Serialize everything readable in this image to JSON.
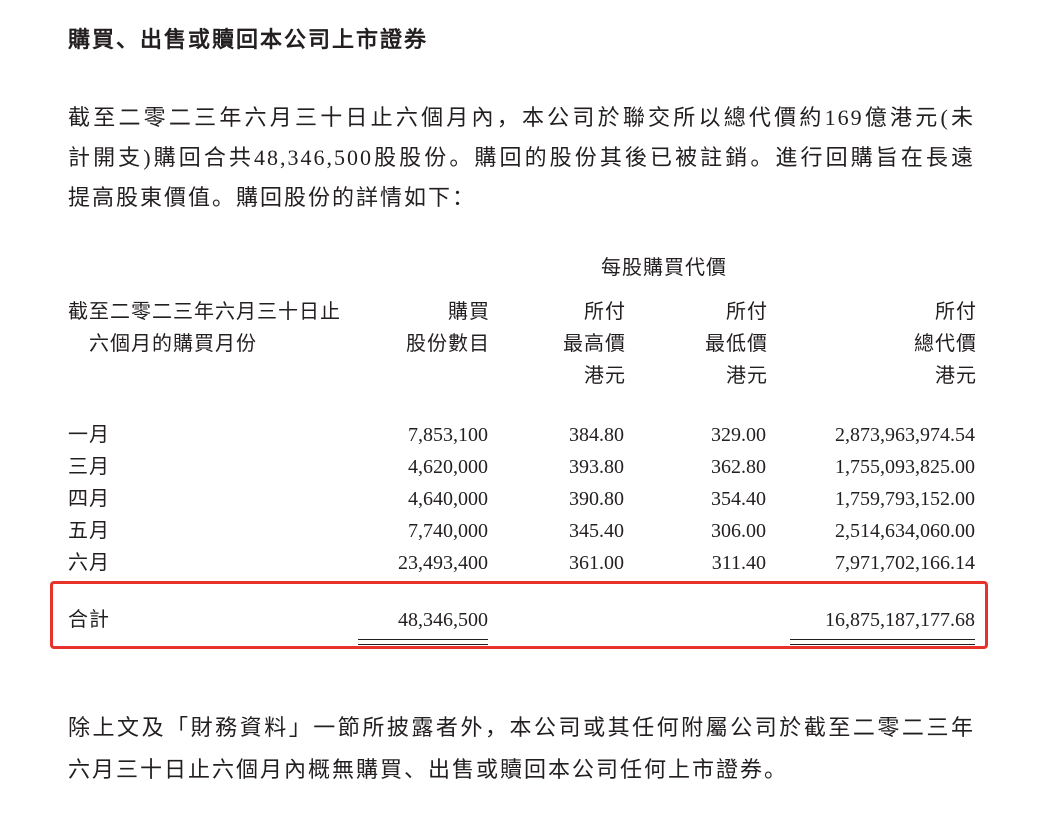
{
  "heading": "購買、出售或贖回本公司上市證券",
  "intro_lines": [
    "截至二零二三年六月三十日止六個月內，本公司於聯交所以總代價約169億港元(未",
    "計開支)購回合共48,346,500股股份。購回的股份其後已被註銷。進行回購旨在長遠",
    "提高股東價值。購回股份的詳情如下："
  ],
  "table": {
    "group_header": "每股購買代價",
    "columns": [
      [
        "截至二零二三年六月三十日止",
        "六個月的購買月份"
      ],
      [
        "購買",
        "股份數目"
      ],
      [
        "所付",
        "最高價",
        "港元"
      ],
      [
        "所付",
        "最低價",
        "港元"
      ],
      [
        "所付",
        "總代價",
        "港元"
      ]
    ],
    "rows": [
      {
        "month": "一月",
        "shares": "7,853,100",
        "highest_price": "384.80",
        "lowest_price": "329.00",
        "total_consideration": "2,873,963,974.54"
      },
      {
        "month": "三月",
        "shares": "4,620,000",
        "highest_price": "393.80",
        "lowest_price": "362.80",
        "total_consideration": "1,755,093,825.00"
      },
      {
        "month": "四月",
        "shares": "4,640,000",
        "highest_price": "390.80",
        "lowest_price": "354.40",
        "total_consideration": "1,759,793,152.00"
      },
      {
        "month": "五月",
        "shares": "7,740,000",
        "highest_price": "345.40",
        "lowest_price": "306.00",
        "total_consideration": "2,514,634,060.00"
      },
      {
        "month": "六月",
        "shares": "23,493,400",
        "highest_price": "361.00",
        "lowest_price": "311.40",
        "total_consideration": "7,971,702,166.14"
      }
    ],
    "total_row": {
      "label": "合計",
      "shares": "48,346,500",
      "total_consideration": "16,875,187,177.68"
    }
  },
  "closing_lines": [
    "除上文及「財務資料」一節所披露者外，本公司或其任何附屬公司於截至二零二三年",
    "六月三十日止六個月內概無購買、出售或贖回本公司任何上市證券。"
  ],
  "highlight_color": "#e8332b"
}
